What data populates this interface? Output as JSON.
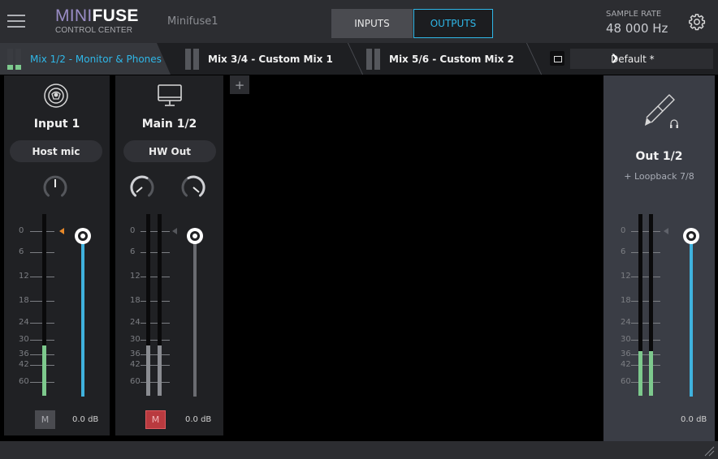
{
  "header": {
    "logo_mini": "MINI",
    "logo_fuse": "FUSE",
    "logo_sub": "CONTROL CENTER",
    "device_name": "Minifuse1",
    "inputs_label": "INPUTS",
    "outputs_label": "OUTPUTS",
    "sample_rate_label": "SAMPLE RATE",
    "sample_rate_value": "48 000 Hz"
  },
  "tabs": [
    {
      "label": "Mix 1/2 - Monitor & Phones",
      "active": true
    },
    {
      "label": "Mix 3/4 - Custom Mix 1",
      "active": false
    },
    {
      "label": "Mix 5/6 - Custom Mix 2",
      "active": false
    }
  ],
  "preset": {
    "value": "Default *"
  },
  "scale_labels": [
    "0",
    "6",
    "12",
    "18",
    "24",
    "30",
    "36",
    "42",
    "60"
  ],
  "add_label": "+",
  "channels": {
    "input1": {
      "name": "Input 1",
      "source": "Host mic",
      "mute_label": "M",
      "muted": false,
      "gain": "0.0 dB"
    },
    "main12": {
      "name": "Main 1/2",
      "source": "HW Out",
      "mute_label": "M",
      "muted": true,
      "gain": "0.0 dB"
    }
  },
  "output": {
    "name": "Out 1/2",
    "sub": "+ Loopback 7/8",
    "gain": "0.0 dB"
  },
  "colors": {
    "accent": "#2fb7e8",
    "meter": "#7dc98d",
    "mute_on": "#b93a3f",
    "peak": "#e8892a"
  }
}
